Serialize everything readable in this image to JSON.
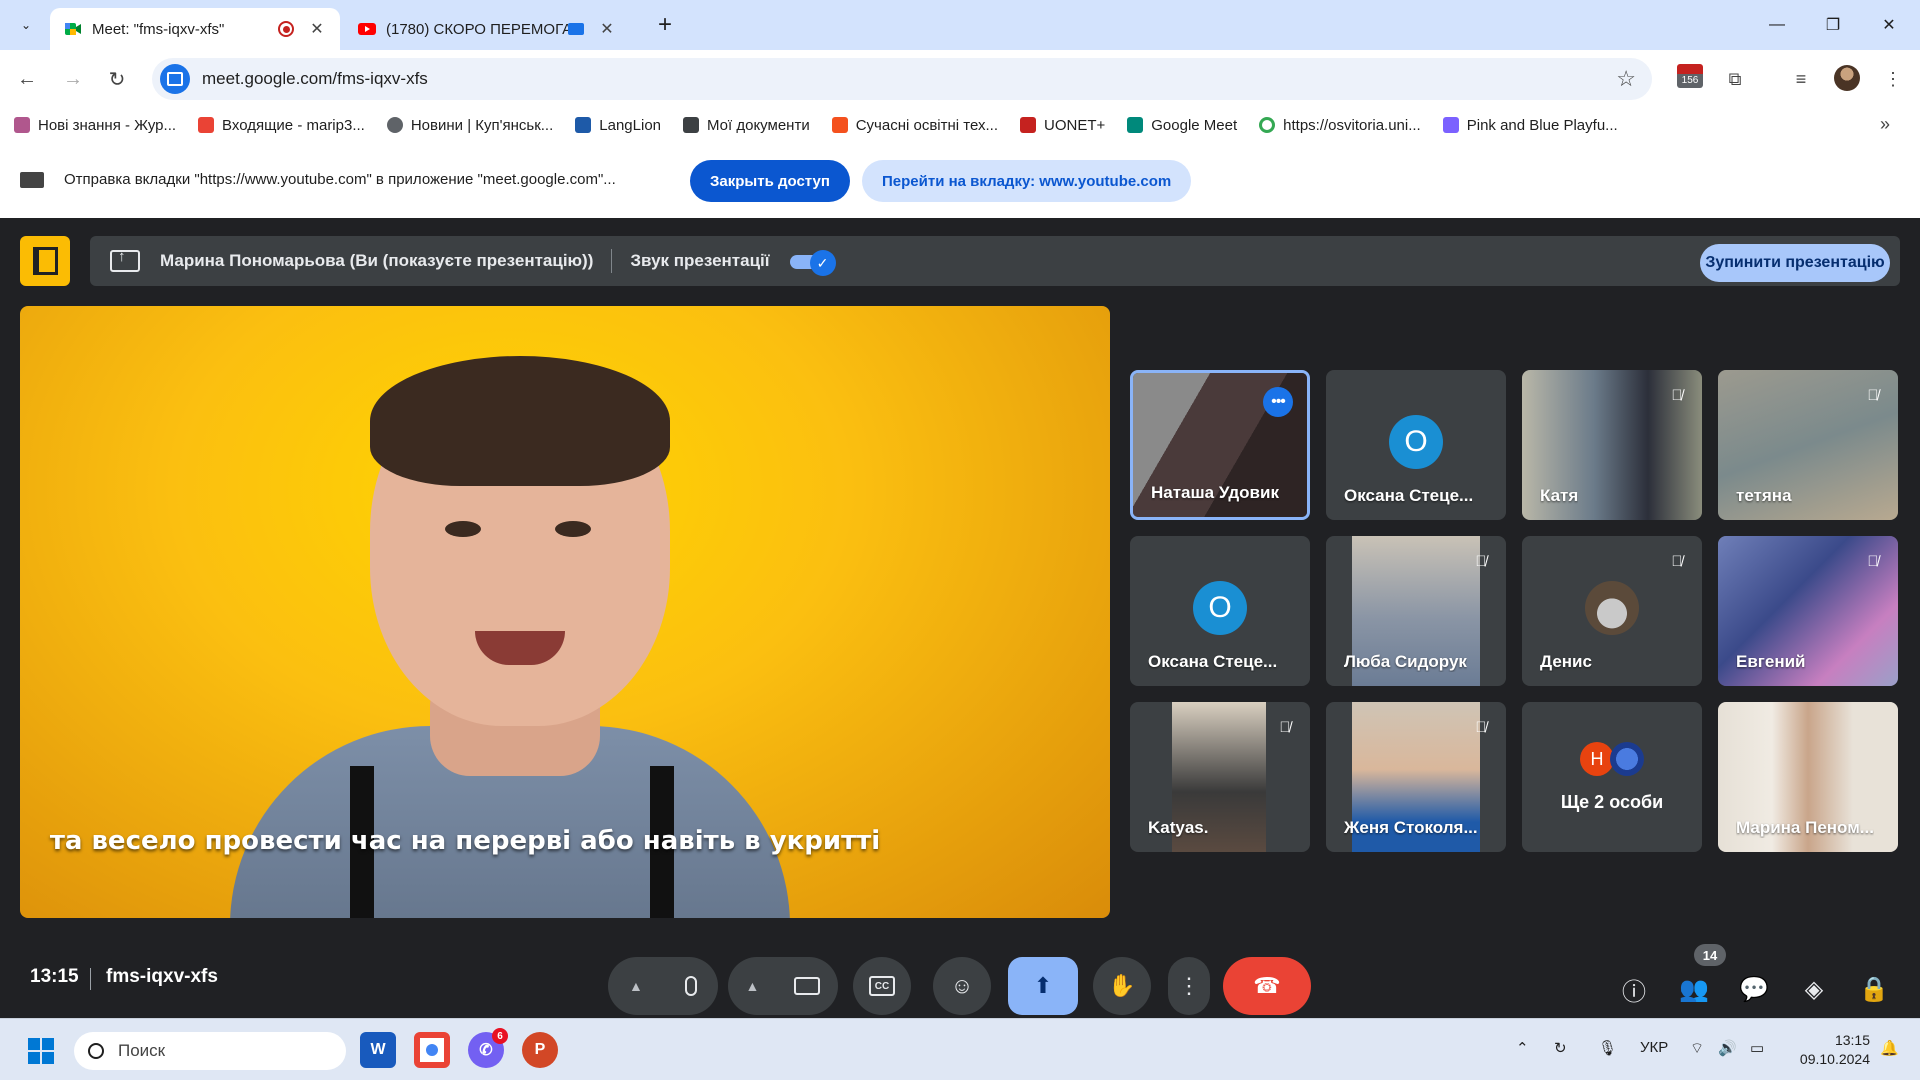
{
  "browser": {
    "tabs": [
      {
        "title": "Meet: \"fms-iqxv-xfs\"",
        "active": true
      },
      {
        "title": "(1780) СКОРО ПЕРЕМОГА |",
        "active": false
      }
    ],
    "close_glyph": "✕",
    "new_tab_glyph": "+",
    "tab_list_glyph": "⌄",
    "window_controls": {
      "minimize": "—",
      "restore": "❐",
      "close": "✕"
    },
    "url": "meet.google.com/fms-iqxv-xfs",
    "calendar_badge": "156",
    "bookmarks": [
      {
        "label": "Нові знання - Жур...",
        "color": "#b0578d"
      },
      {
        "label": "Входящие - marip3...",
        "color": "#ea4335"
      },
      {
        "label": "Новини | Куп'янськ...",
        "color": "#5f6368"
      },
      {
        "label": "LangLion",
        "color": "#1e5aa8"
      },
      {
        "label": "Мої документи",
        "color": "#3c4043"
      },
      {
        "label": "Сучасні освітні тех...",
        "color": "#f4511e"
      },
      {
        "label": "UONET+",
        "color": "#c5221f"
      },
      {
        "label": "Google Meet",
        "color": "#00897b"
      },
      {
        "label": "https://osvitoria.uni...",
        "color": "#34a853"
      },
      {
        "label": "Pink and Blue Playfu...",
        "color": "#7b61ff"
      }
    ],
    "bookmarks_more": "»",
    "infobar": {
      "message": "Отправка вкладки \"https://www.youtube.com\" в приложение \"meet.google.com\"...",
      "close_access": "Закрыть доступ",
      "goto_tab": "Перейти на вкладку: www.youtube.com"
    }
  },
  "meet": {
    "presenter_text": "Марина Пономарьова (Ви (показуєте презентацію))",
    "sound_label": "Звук презентації",
    "stop_presenting": "Зупинити презентацію",
    "caption": "та весело провести час на перерві або навіть в укритті",
    "tiles": [
      {
        "name": "Наташа Удовик",
        "type": "video",
        "active": true
      },
      {
        "name": "Оксана Стеце...",
        "type": "avatar",
        "initial": "О"
      },
      {
        "name": "Катя",
        "type": "video",
        "muted": true
      },
      {
        "name": "тетяна",
        "type": "video",
        "muted": true
      },
      {
        "name": "Оксана Стеце...",
        "type": "avatar",
        "initial": "О"
      },
      {
        "name": "Люба Сидорук",
        "type": "video",
        "muted": true
      },
      {
        "name": "Денис",
        "type": "photo",
        "muted": true
      },
      {
        "name": "Евгений",
        "type": "video",
        "muted": true
      },
      {
        "name": "Katyas.",
        "type": "video",
        "muted": true
      },
      {
        "name": "Женя Стоколя...",
        "type": "video",
        "muted": true
      },
      {
        "name": "Ще 2 особи",
        "type": "more",
        "initial": "Н"
      },
      {
        "name": "Марина Пеном...",
        "type": "video"
      }
    ],
    "bottom": {
      "time": "13:15",
      "meeting_code": "fms-iqxv-xfs",
      "participants_count": "14"
    }
  },
  "taskbar": {
    "search_placeholder": "Поиск",
    "language": "УКР",
    "time": "13:15",
    "date": "09.10.2024",
    "viber_badge": "6"
  }
}
